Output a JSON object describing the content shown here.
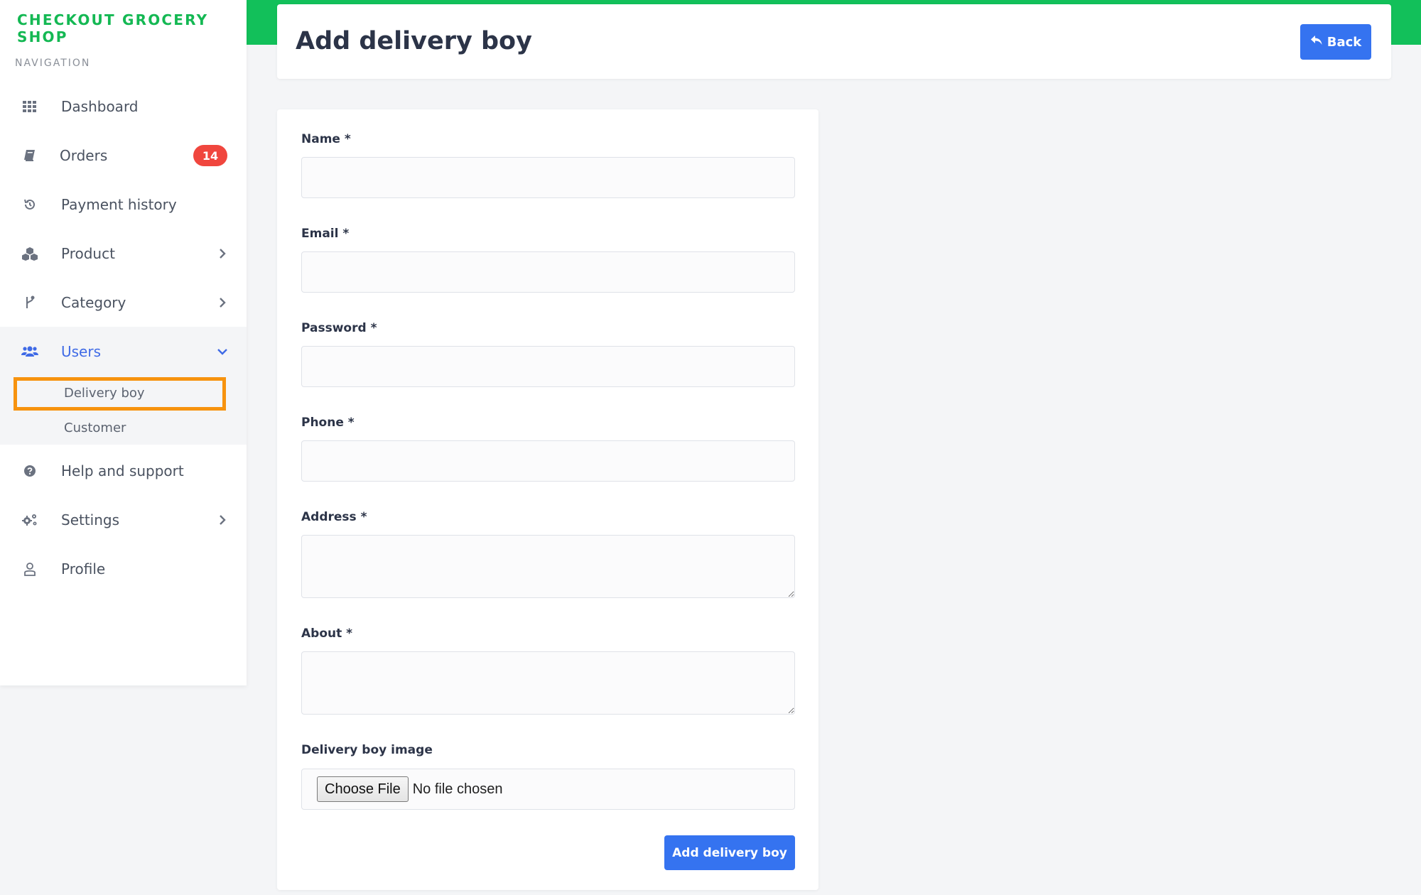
{
  "brand": "CHECKOUT GROCERY SHOP",
  "sidebar": {
    "section_title": "NAVIGATION",
    "items": [
      {
        "label": "Dashboard",
        "icon": "grid-icon"
      },
      {
        "label": "Orders",
        "icon": "book-icon",
        "badge": "14"
      },
      {
        "label": "Payment history",
        "icon": "history-icon"
      },
      {
        "label": "Product",
        "icon": "cubes-icon",
        "expandable": true
      },
      {
        "label": "Category",
        "icon": "branch-icon",
        "expandable": true
      },
      {
        "label": "Users",
        "icon": "users-icon",
        "expanded": true
      },
      {
        "label": "Help and support",
        "icon": "question-circle-icon"
      },
      {
        "label": "Settings",
        "icon": "gears-icon",
        "expandable": true
      },
      {
        "label": "Profile",
        "icon": "user-outline-icon"
      }
    ],
    "users_submenu": [
      {
        "label": "Delivery boy",
        "highlighted": true
      },
      {
        "label": "Customer"
      }
    ]
  },
  "header": {
    "title": "Add delivery boy",
    "back_label": "Back"
  },
  "form": {
    "name_label": "Name *",
    "name_value": "",
    "email_label": "Email *",
    "email_value": "",
    "password_label": "Password *",
    "password_value": "",
    "phone_label": "Phone *",
    "phone_value": "",
    "address_label": "Address *",
    "address_value": "",
    "about_label": "About *",
    "about_value": "",
    "image_label": "Delivery boy image",
    "file_button_label": "Choose File",
    "file_status": "No file chosen",
    "submit_label": "Add delivery boy"
  },
  "colors": {
    "brand_green": "#14b853",
    "primary_blue": "#3573f0",
    "active_blue": "#3f6ae6",
    "badge_red": "#f0463e",
    "highlight_orange": "#f7930f"
  }
}
